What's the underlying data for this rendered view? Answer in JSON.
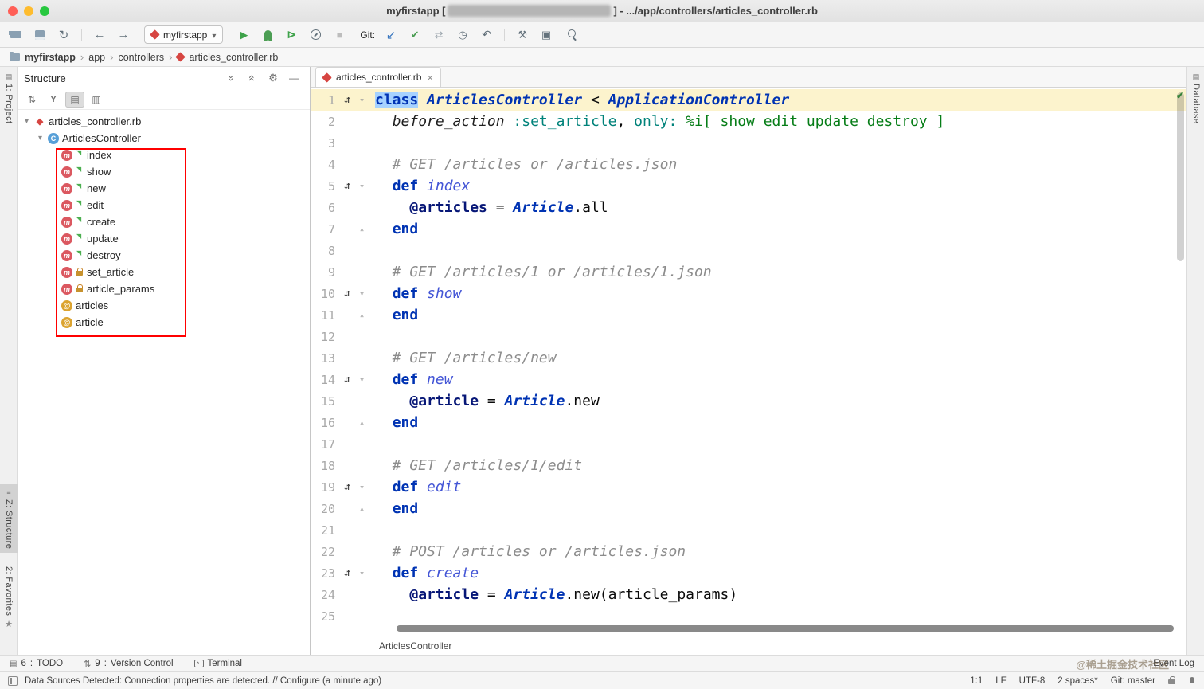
{
  "window": {
    "title_prefix": "myfirstapp [",
    "title_suffix": "] - .../app/controllers/articles_controller.rb"
  },
  "toolbar": {
    "left_icons": [
      "open-project",
      "save-all",
      "synchronize"
    ],
    "nav_icons": [
      "back",
      "forward"
    ],
    "run_config": "myfirstapp",
    "run_icons": [
      "run",
      "debug",
      "run-with-coverage",
      "profile",
      "stop"
    ],
    "git_label": "Git:",
    "git_icons": [
      "update-project",
      "commit",
      "compare",
      "history",
      "rollback"
    ],
    "tool_icons": [
      "wrench",
      "console",
      "search"
    ]
  },
  "breadcrumbs": {
    "items": [
      {
        "label": "myfirstapp",
        "icon": "folder",
        "bold": true
      },
      {
        "label": "app",
        "icon": null,
        "bold": false
      },
      {
        "label": "controllers",
        "icon": null,
        "bold": false
      },
      {
        "label": "articles_controller.rb",
        "icon": "ruby",
        "bold": false
      }
    ]
  },
  "structure": {
    "title": "Structure",
    "toolbar_icons": [
      {
        "name": "sort-by-visibility-icon",
        "pressed": false
      },
      {
        "name": "sort-alphabetically-icon",
        "pressed": false
      },
      {
        "name": "show-methods-icon",
        "pressed": true
      },
      {
        "name": "show-fields-icon",
        "pressed": false
      }
    ],
    "tree": [
      {
        "label": "articles_controller.rb",
        "icon": "ruby-file",
        "indent": 0,
        "expander": true
      },
      {
        "label": "ArticlesController",
        "icon": "class",
        "indent": 1,
        "expander": true
      },
      {
        "label": "index",
        "icon": "method-public",
        "indent": 2
      },
      {
        "label": "show",
        "icon": "method-public",
        "indent": 2
      },
      {
        "label": "new",
        "icon": "method-public",
        "indent": 2
      },
      {
        "label": "edit",
        "icon": "method-public",
        "indent": 2
      },
      {
        "label": "create",
        "icon": "method-public",
        "indent": 2
      },
      {
        "label": "update",
        "icon": "method-public",
        "indent": 2
      },
      {
        "label": "destroy",
        "icon": "method-public",
        "indent": 2
      },
      {
        "label": "set_article",
        "icon": "method-private",
        "indent": 2
      },
      {
        "label": "article_params",
        "icon": "method-private",
        "indent": 2
      },
      {
        "label": "articles",
        "icon": "field",
        "indent": 2
      },
      {
        "label": "article",
        "icon": "field",
        "indent": 2
      }
    ]
  },
  "editor": {
    "tab": {
      "label": "articles_controller.rb"
    },
    "breadcrumb_bottom": "ArticlesController",
    "lines": [
      {
        "n": 1,
        "gutter": true,
        "fold": "open",
        "highlight": true,
        "tokens": [
          {
            "s": "kw sel",
            "t": "class"
          },
          {
            "s": "pln",
            "t": " "
          },
          {
            "s": "cls",
            "t": "ArticlesController"
          },
          {
            "s": "pln",
            "t": " < "
          },
          {
            "s": "cls",
            "t": "ApplicationController"
          }
        ]
      },
      {
        "n": 2,
        "tokens": [
          {
            "s": "pln",
            "t": "  "
          },
          {
            "s": "call",
            "t": "before_action"
          },
          {
            "s": "pln",
            "t": " "
          },
          {
            "s": "sym",
            "t": ":set_article"
          },
          {
            "s": "pln",
            "t": ", "
          },
          {
            "s": "sym",
            "t": "only:"
          },
          {
            "s": "pln",
            "t": " "
          },
          {
            "s": "str",
            "t": "%i[ show edit update destroy ]"
          }
        ]
      },
      {
        "n": 3,
        "tokens": []
      },
      {
        "n": 4,
        "tokens": [
          {
            "s": "cmt",
            "t": "  # GET /articles or /articles.json"
          }
        ]
      },
      {
        "n": 5,
        "gutter": true,
        "fold": "open",
        "tokens": [
          {
            "s": "pln",
            "t": "  "
          },
          {
            "s": "kw",
            "t": "def"
          },
          {
            "s": "pln",
            "t": " "
          },
          {
            "s": "defn",
            "t": "index"
          }
        ]
      },
      {
        "n": 6,
        "tokens": [
          {
            "s": "pln",
            "t": "    "
          },
          {
            "s": "ivar",
            "t": "@articles"
          },
          {
            "s": "pln",
            "t": " = "
          },
          {
            "s": "cls",
            "t": "Article"
          },
          {
            "s": "pln",
            "t": ".all"
          }
        ]
      },
      {
        "n": 7,
        "fold": "close",
        "tokens": [
          {
            "s": "pln",
            "t": "  "
          },
          {
            "s": "kw",
            "t": "end"
          }
        ]
      },
      {
        "n": 8,
        "tokens": []
      },
      {
        "n": 9,
        "tokens": [
          {
            "s": "cmt",
            "t": "  # GET /articles/1 or /articles/1.json"
          }
        ]
      },
      {
        "n": 10,
        "gutter": true,
        "fold": "open",
        "tokens": [
          {
            "s": "pln",
            "t": "  "
          },
          {
            "s": "kw",
            "t": "def"
          },
          {
            "s": "pln",
            "t": " "
          },
          {
            "s": "defn",
            "t": "show"
          }
        ]
      },
      {
        "n": 11,
        "fold": "close",
        "tokens": [
          {
            "s": "pln",
            "t": "  "
          },
          {
            "s": "kw",
            "t": "end"
          }
        ]
      },
      {
        "n": 12,
        "tokens": []
      },
      {
        "n": 13,
        "tokens": [
          {
            "s": "cmt",
            "t": "  # GET /articles/new"
          }
        ]
      },
      {
        "n": 14,
        "gutter": true,
        "fold": "open",
        "tokens": [
          {
            "s": "pln",
            "t": "  "
          },
          {
            "s": "kw",
            "t": "def"
          },
          {
            "s": "pln",
            "t": " "
          },
          {
            "s": "defn",
            "t": "new"
          }
        ]
      },
      {
        "n": 15,
        "tokens": [
          {
            "s": "pln",
            "t": "    "
          },
          {
            "s": "ivar",
            "t": "@article"
          },
          {
            "s": "pln",
            "t": " = "
          },
          {
            "s": "cls",
            "t": "Article"
          },
          {
            "s": "pln",
            "t": ".new"
          }
        ]
      },
      {
        "n": 16,
        "fold": "close",
        "tokens": [
          {
            "s": "pln",
            "t": "  "
          },
          {
            "s": "kw",
            "t": "end"
          }
        ]
      },
      {
        "n": 17,
        "tokens": []
      },
      {
        "n": 18,
        "tokens": [
          {
            "s": "cmt",
            "t": "  # GET /articles/1/edit"
          }
        ]
      },
      {
        "n": 19,
        "gutter": true,
        "fold": "open",
        "tokens": [
          {
            "s": "pln",
            "t": "  "
          },
          {
            "s": "kw",
            "t": "def"
          },
          {
            "s": "pln",
            "t": " "
          },
          {
            "s": "defn",
            "t": "edit"
          }
        ]
      },
      {
        "n": 20,
        "fold": "close",
        "tokens": [
          {
            "s": "pln",
            "t": "  "
          },
          {
            "s": "kw",
            "t": "end"
          }
        ]
      },
      {
        "n": 21,
        "tokens": []
      },
      {
        "n": 22,
        "tokens": [
          {
            "s": "cmt",
            "t": "  # POST /articles or /articles.json"
          }
        ]
      },
      {
        "n": 23,
        "gutter": true,
        "fold": "open",
        "tokens": [
          {
            "s": "pln",
            "t": "  "
          },
          {
            "s": "kw",
            "t": "def"
          },
          {
            "s": "pln",
            "t": " "
          },
          {
            "s": "defn",
            "t": "create"
          }
        ]
      },
      {
        "n": 24,
        "tokens": [
          {
            "s": "pln",
            "t": "    "
          },
          {
            "s": "ivar",
            "t": "@article"
          },
          {
            "s": "pln",
            "t": " = "
          },
          {
            "s": "cls",
            "t": "Article"
          },
          {
            "s": "pln",
            "t": ".new(article_params)"
          }
        ]
      },
      {
        "n": 25,
        "tokens": []
      }
    ]
  },
  "stripes": {
    "left": [
      {
        "label": "1: Project",
        "selected": false
      },
      {
        "label": "Z: Structure",
        "selected": true
      },
      {
        "label": "2: Favorites",
        "selected": false
      }
    ],
    "right": [
      {
        "label": "Database",
        "selected": false
      }
    ]
  },
  "tool_buttons": [
    {
      "mnemonic": "6",
      "label": "TODO",
      "icon": "todo"
    },
    {
      "mnemonic": "9",
      "label": "Version Control",
      "icon": "version-control"
    },
    {
      "mnemonic": "",
      "label": "Terminal",
      "icon": "terminal"
    }
  ],
  "event_log": "Event Log",
  "watermark": "@稀土掘金技术社区",
  "status_bar": {
    "message": "Data Sources Detected: Connection properties are detected. // Configure (a minute ago)",
    "right_items": [
      "1:1",
      "LF",
      "UTF-8",
      "2 spaces*",
      "Git: master"
    ]
  },
  "colors": {
    "selection": "#a6d2ff",
    "current_line": "#fcf3cd",
    "annotation": "#ff0000",
    "run_green": "#3ea24a"
  }
}
